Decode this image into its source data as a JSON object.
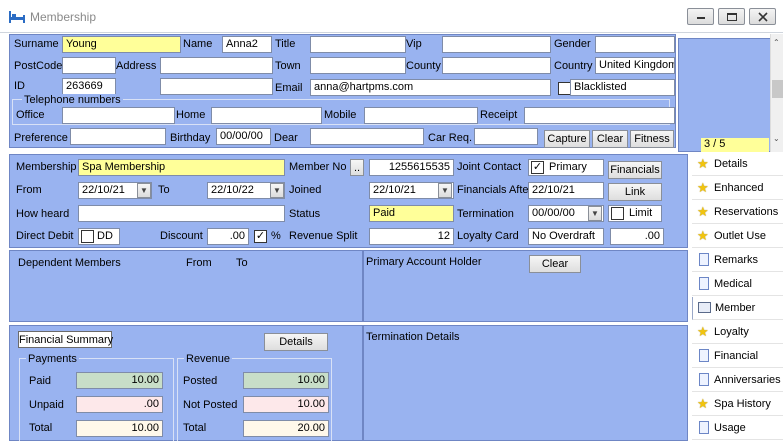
{
  "window": {
    "title": "Membership"
  },
  "top": {
    "surname_label": "Surname",
    "surname": "Young",
    "name_label": "Name",
    "name": "Anna2",
    "title_label": "Title",
    "title": "",
    "vip_label": "Vip",
    "vip": "",
    "gender_label": "Gender",
    "gender": "",
    "postcode_label": "PostCode",
    "postcode": "",
    "address_label": "Address",
    "address": "",
    "town_label": "Town",
    "town": "",
    "county_label": "County",
    "county": "",
    "country_label": "Country",
    "country": "United Kingdom",
    "id_label": "ID",
    "id": "263669",
    "email_label": "Email",
    "email": "anna@hartpms.com",
    "blacklisted_label": "Blacklisted",
    "telephone_label": "Telephone numbers",
    "office_label": "Office",
    "home_label": "Home",
    "mobile_label": "Mobile",
    "receipt_label": "Receipt",
    "preference_label": "Preference",
    "birthday_label": "Birthday",
    "birthday": "00/00/00",
    "dear_label": "Dear",
    "carreq_label": "Car Req.",
    "capture_label": "Capture",
    "clear_label": "Clear",
    "fitness_label": "Fitness",
    "photo_counter": "3 / 5"
  },
  "membership": {
    "membership_label": "Membership",
    "membership": "Spa Membership",
    "memberno_label": "Member No",
    "memberno_btn": "..",
    "memberno": "1255615535",
    "joint_label": "Joint Contact",
    "primary_label": "Primary",
    "financials_btn": "Financials",
    "from_label": "From",
    "from": "22/10/21",
    "to_label": "To",
    "to": "22/10/22",
    "joined_label": "Joined",
    "joined": "22/10/21",
    "financials_after_label": "Financials Afte",
    "financials_after": "22/10/21",
    "link_btn": "Link",
    "howheard_label": "How heard",
    "status_label": "Status",
    "status": "Paid",
    "termination_label": "Termination",
    "termination": "00/00/00",
    "limit_label": "Limit",
    "directdebit_label": "Direct Debit",
    "dd_label": "DD",
    "discount_label": "Discount",
    "discount": ".00",
    "percent_label": "%",
    "revsplit_label": "Revenue Split",
    "revsplit": "12",
    "loyalty_label": "Loyalty Card",
    "loyalty": "No Overdraft",
    "loyalty_amount": ".00"
  },
  "dependents": {
    "header": "Dependent Members",
    "from_col": "From",
    "to_col": "To"
  },
  "primary_holder": {
    "label": "Primary Account Holder",
    "clear_btn": "Clear"
  },
  "financial": {
    "summary_btn": "Financial Summary",
    "details_btn": "Details",
    "payments_title": "Payments",
    "paid_label": "Paid",
    "paid": "10.00",
    "unpaid_label": "Unpaid",
    "unpaid": ".00",
    "total_label": "Total",
    "total": "10.00",
    "revenue_title": "Revenue",
    "posted_label": "Posted",
    "posted": "10.00",
    "notposted_label": "Not Posted",
    "notposted": "10.00",
    "rtotal_label": "Total",
    "rtotal": "20.00"
  },
  "termination_details": {
    "label": "Termination Details"
  },
  "right_panel": {
    "items": [
      {
        "label": "Details",
        "icon": "star"
      },
      {
        "label": "Enhanced",
        "icon": "star"
      },
      {
        "label": "Reservations",
        "icon": "star"
      },
      {
        "label": "Outlet Use",
        "icon": "star"
      },
      {
        "label": "Remarks",
        "icon": "document"
      },
      {
        "label": "Medical",
        "icon": "document"
      },
      {
        "label": "Member",
        "icon": "member-card"
      },
      {
        "label": "Loyalty",
        "icon": "star"
      },
      {
        "label": "Financial",
        "icon": "document"
      },
      {
        "label": "Anniversaries",
        "icon": "document"
      },
      {
        "label": "Spa History",
        "icon": "star"
      },
      {
        "label": "Usage",
        "icon": "document"
      }
    ]
  },
  "colors": {
    "panel_bg": "#99b3f0",
    "highlight_yellow": "#ffff99",
    "paid_green": "#c8dec8",
    "unpaid_pink": "#fde8ea"
  }
}
